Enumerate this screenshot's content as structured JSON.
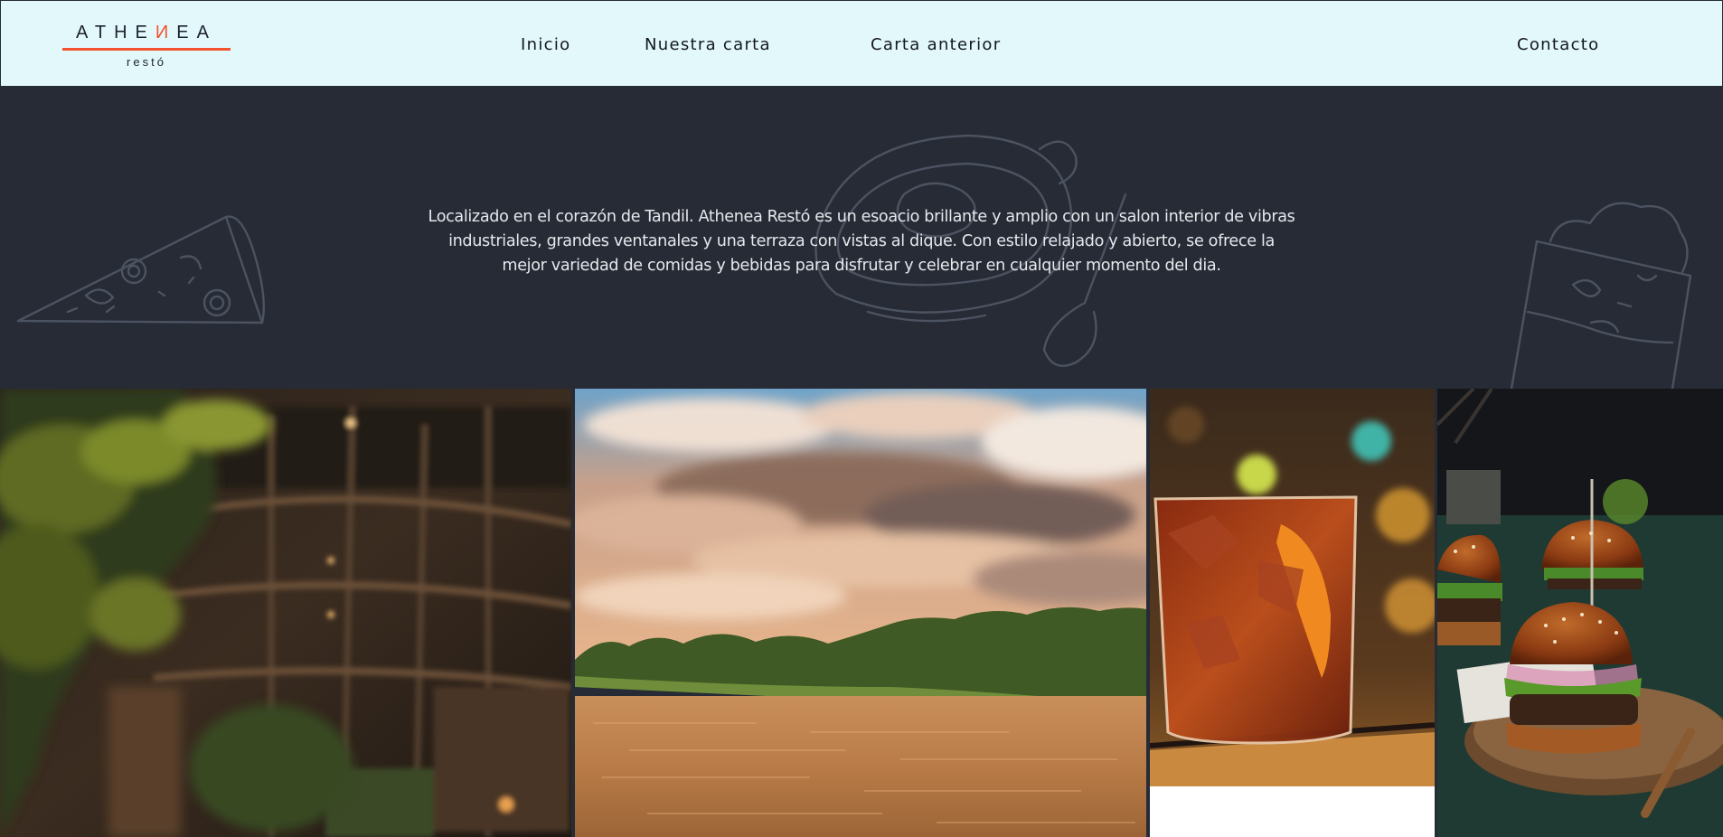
{
  "brand": {
    "name_before": "ATHE",
    "name_accent": "И",
    "name_after": "EA",
    "subtitle": "restó",
    "accent_color": "#f1532e"
  },
  "nav": {
    "items": [
      {
        "label": "Inicio"
      },
      {
        "label": "Nuestra carta"
      },
      {
        "label": "Carta anterior"
      },
      {
        "label": "Contacto"
      }
    ]
  },
  "hero": {
    "description": "Localizado en el corazón de Tandil. Athenea Restó es un esoacio brillante y amplio con un salon interior de vibras industriales, grandes ventanales y una terraza con vistas al dique. Con estilo relajado y abierto, se ofrece la mejor variedad de comidas y bebidas para disfrutar y celebrar en cualquier momento del dia.",
    "background_color": "#262b36",
    "decorations": [
      "pizza-sketch",
      "soup-bowl-sketch",
      "dessert-glass-sketch"
    ]
  },
  "gallery": {
    "photos": [
      {
        "subject": "restaurant-interior-photo"
      },
      {
        "subject": "lake-sunset-photo"
      },
      {
        "subject": "cocktail-glass-photo"
      },
      {
        "subject": "burgers-photo"
      }
    ]
  }
}
